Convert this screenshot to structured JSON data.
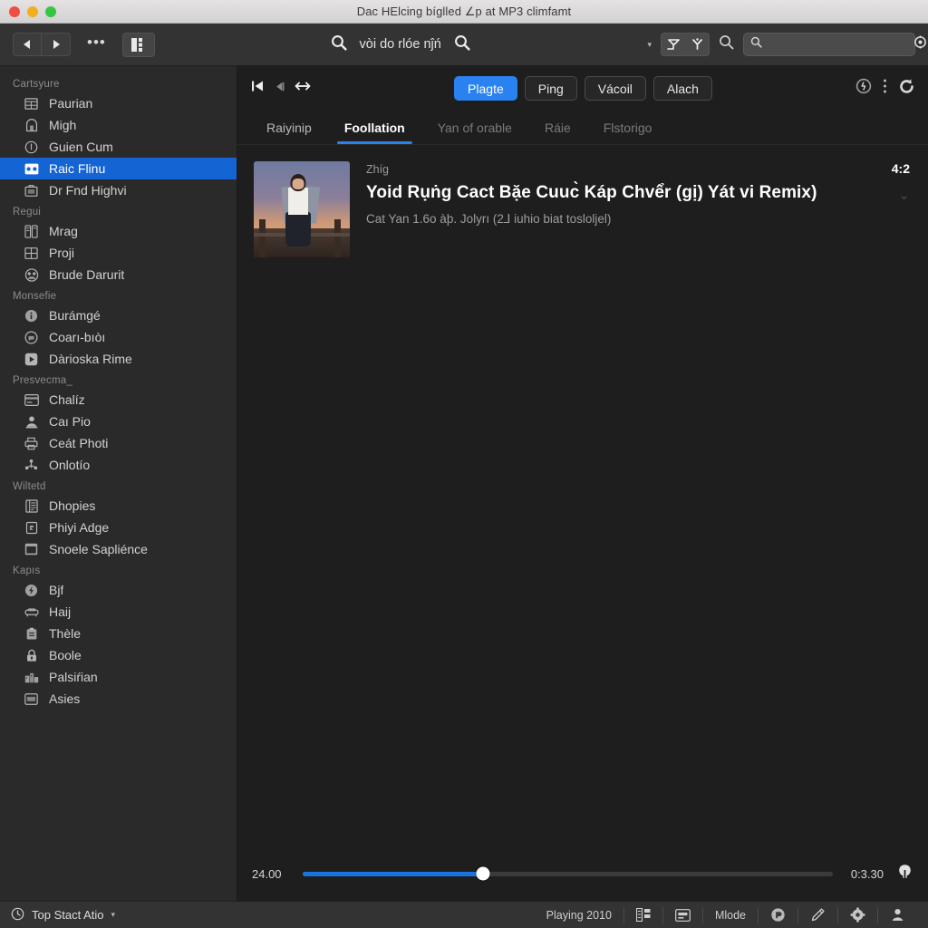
{
  "window": {
    "title": "Dac HElcing bíglled ∠p at MP3 climfamt"
  },
  "toolbar": {
    "back_label": "Back",
    "forward_label": "Forward",
    "overflow_label": "•••",
    "grid_label": "Grid view",
    "center_text": "vòi do rlóe nĵń",
    "caret": "▾",
    "toggle_a": "Toggle A",
    "toggle_b": "Toggle B",
    "search_placeholder": "",
    "search_value": ""
  },
  "sidebar": {
    "groups": [
      {
        "title": "Cartsyure",
        "items": [
          {
            "label": "Paurian",
            "icon": "building-icon",
            "active": false
          },
          {
            "label": "Migh",
            "icon": "archive-icon",
            "active": false
          },
          {
            "label": "Guien Cum",
            "icon": "clock-icon",
            "active": false
          },
          {
            "label": "Raic Flinu",
            "icon": "radio-icon",
            "active": true
          },
          {
            "label": "Dr Fnd Highvi",
            "icon": "briefcase-icon",
            "active": false
          }
        ]
      },
      {
        "title": "Regui",
        "items": [
          {
            "label": "Mrag",
            "icon": "calculator-icon",
            "active": false
          },
          {
            "label": "Proji",
            "icon": "table-icon",
            "active": false
          },
          {
            "label": "Brude Darurit",
            "icon": "group-icon",
            "active": false
          }
        ]
      },
      {
        "title": "Monsefie",
        "items": [
          {
            "label": "Burámgé",
            "icon": "info-icon",
            "active": false
          },
          {
            "label": "Coarı-bıòı",
            "icon": "chat-icon",
            "active": false
          },
          {
            "label": "Dàrioska Rime",
            "icon": "play-box-icon",
            "active": false
          }
        ]
      },
      {
        "title": "Presvecma_",
        "items": [
          {
            "label": "Chalíz",
            "icon": "card-icon",
            "active": false
          },
          {
            "label": "Caı Pio",
            "icon": "person-icon",
            "active": false
          },
          {
            "label": "Ceát Photi",
            "icon": "print-icon",
            "active": false
          },
          {
            "label": "Onlotío",
            "icon": "share-icon",
            "active": false
          }
        ]
      },
      {
        "title": "Wiltetd",
        "items": [
          {
            "label": "Dhopies",
            "icon": "list-doc-icon",
            "active": false
          },
          {
            "label": "Phiyi Adge",
            "icon": "page-icon",
            "active": false
          },
          {
            "label": "Snoele Sapliénce",
            "icon": "window-icon",
            "active": false
          }
        ]
      },
      {
        "title": "Kapıs",
        "items": [
          {
            "label": "Bjf",
            "icon": "bolt-icon",
            "active": false
          },
          {
            "label": "Haij",
            "icon": "sofa-icon",
            "active": false
          },
          {
            "label": "Thèle",
            "icon": "clipboard-icon",
            "active": false
          },
          {
            "label": "Boole",
            "icon": "lock-icon",
            "active": false
          },
          {
            "label": "Palsiŕian",
            "icon": "city-icon",
            "active": false
          },
          {
            "label": "Asies",
            "icon": "badge-icon",
            "active": false
          }
        ]
      }
    ]
  },
  "main": {
    "transport": {
      "skip_back": "skip-back-icon",
      "previous": "previous-icon",
      "swap": "swap-icon"
    },
    "pills": [
      {
        "label": "Plagte",
        "active": true
      },
      {
        "label": "Ping",
        "active": false
      },
      {
        "label": "Vácoil",
        "active": false
      },
      {
        "label": "Alach",
        "active": false
      }
    ],
    "head_icons": [
      "history-icon",
      "more-vertical-icon",
      "refresh-icon"
    ],
    "subtabs": [
      {
        "label": "Raiyinip",
        "state": "normal"
      },
      {
        "label": "Foollation",
        "state": "active"
      },
      {
        "label": "Yan of orable",
        "state": "dim"
      },
      {
        "label": "Ráie",
        "state": "dim"
      },
      {
        "label": "Flstorigo",
        "state": "dim"
      }
    ],
    "tracks": [
      {
        "kicker": "Zhíg",
        "title": "Yoid Rụṅg Cact Bặe Cuuc̀ Káp Chvểr (gị) Yát vi Remix)",
        "subtitle": "Cat Yan 1.6o àþ. Jolyrı (2⅃ iuhio biat tosloljel)",
        "duration": "4:2",
        "chevron": "⌄"
      }
    ]
  },
  "player": {
    "elapsed": "24.00",
    "remaining": "0:3.30",
    "progress_percent": 34,
    "cast_icon": "cast-icon"
  },
  "status": {
    "left_label": "Top Stact Atio",
    "left_caret": "▾",
    "left_icon": "clock-circle-icon",
    "playing_label": "Playing 2010",
    "mode_label": "Mlode",
    "icons": [
      "equalizer-icon",
      "subtitle-icon",
      "volume-knob-icon",
      "edit-icon",
      "settings-icon",
      "account-icon"
    ]
  },
  "colors": {
    "accent": "#2a82f0",
    "sidebar_active": "#1564d4",
    "seek_fill": "#1a74e0",
    "window_bg": "#1e1e1e",
    "sidebar_bg": "#2a2a2a",
    "toolbar_bg": "#333333"
  }
}
